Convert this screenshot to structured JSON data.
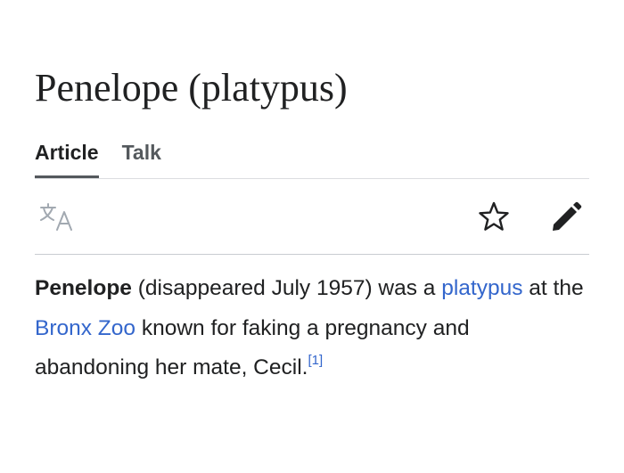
{
  "article": {
    "title": "Penelope (platypus)"
  },
  "tabs": [
    {
      "label": "Article",
      "active": true
    },
    {
      "label": "Talk",
      "active": false
    }
  ],
  "toolbar": {
    "icons": [
      "language-icon",
      "star-icon",
      "edit-pencil-icon"
    ]
  },
  "lead": {
    "subject": "Penelope",
    "text_1": " (disappeared July 1957) was a ",
    "link_1": "platypus",
    "text_2": " at the ",
    "link_2": "Bronx Zoo",
    "text_3": " known for faking a pregnancy and abandoning her mate, Cecil.",
    "reference": "[1]"
  },
  "colors": {
    "text": "#202122",
    "link": "#3366cc",
    "muted": "#54595d",
    "divider": "#c8ccd1"
  }
}
